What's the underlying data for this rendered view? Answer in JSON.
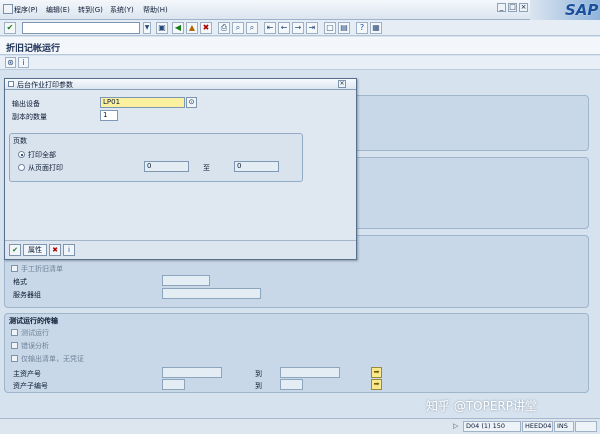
{
  "menubar": {
    "items": [
      "程序(P)",
      "编辑(E)",
      "转到(G)",
      "系统(Y)",
      "帮助(H)"
    ],
    "logo": "SAP"
  },
  "title": "折旧记帐运行",
  "dialog": {
    "title": "后台作业打印参数",
    "output_device_label": "输出设备",
    "output_device_value": "LP01",
    "copies_label": "副本的数量",
    "copies_value": "1",
    "pages_group_title": "页数",
    "print_all_label": "打印全部",
    "print_from_label": "从页面打印",
    "page_from_value": "0",
    "to_label": "至",
    "page_to_value": "0",
    "properties_button": "属性"
  },
  "background": {
    "manual_depr_list": "手工折旧清单",
    "format_label": "格式",
    "server_group_label": "服务器组",
    "test_run_section": "测试运行的传输",
    "test_run": "测试运行",
    "error_analysis": "错误分析",
    "output_list_only": "仅输出清单，无凭证",
    "main_asset_label": "主资产号",
    "asset_sub_label": "资产子编号",
    "to_label": "到"
  },
  "statusbar": {
    "system": "D04 (1) 150",
    "server": "HEED04",
    "mode": "INS"
  },
  "watermark": "知乎 @TOPERP讲堂"
}
